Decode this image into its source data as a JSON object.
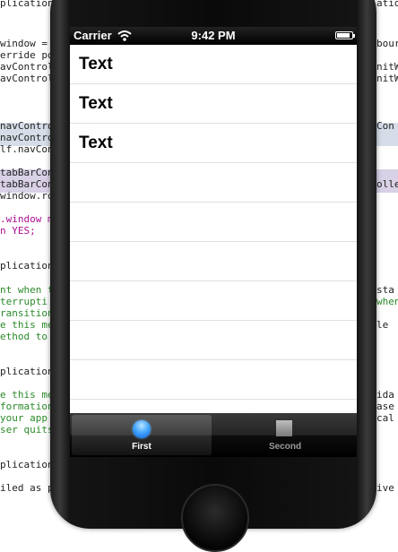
{
  "status_bar": {
    "carrier": "Carrier",
    "time": "9:42 PM",
    "battery_level": 0.9
  },
  "table": {
    "rows": [
      "Text",
      "Text",
      "Text",
      "",
      "",
      "",
      "",
      "",
      ""
    ]
  },
  "tab_bar": {
    "tabs": [
      {
        "label": "First",
        "selected": true,
        "icon": "circle-icon"
      },
      {
        "label": "Second",
        "selected": false,
        "icon": "square-icon"
      }
    ]
  },
  "editor": {
    "lines": [
      "plication",
      "ation",
      "window =",
      "bour",
      "erride po",
      "",
      "avControl",
      "nitW",
      "avControl",
      "nitW",
      "navContro",
      "Con",
      "navContro",
      "",
      "lf.navCon",
      "",
      "tabBarCon",
      "",
      "tabBarCon",
      "olle",
      "window.ro",
      "",
      ".window m",
      "",
      "n YES;",
      "",
      "plication",
      "",
      "nt when t",
      "sta",
      "terrupti",
      "when",
      "ransition",
      "",
      "e this me",
      "le",
      "ethod to",
      "",
      "plication",
      "",
      "e this me",
      "ida",
      "formation",
      "ase",
      " your app",
      "cal",
      "ser quits",
      "",
      "plication",
      "",
      "iled as p",
      "ive"
    ]
  }
}
